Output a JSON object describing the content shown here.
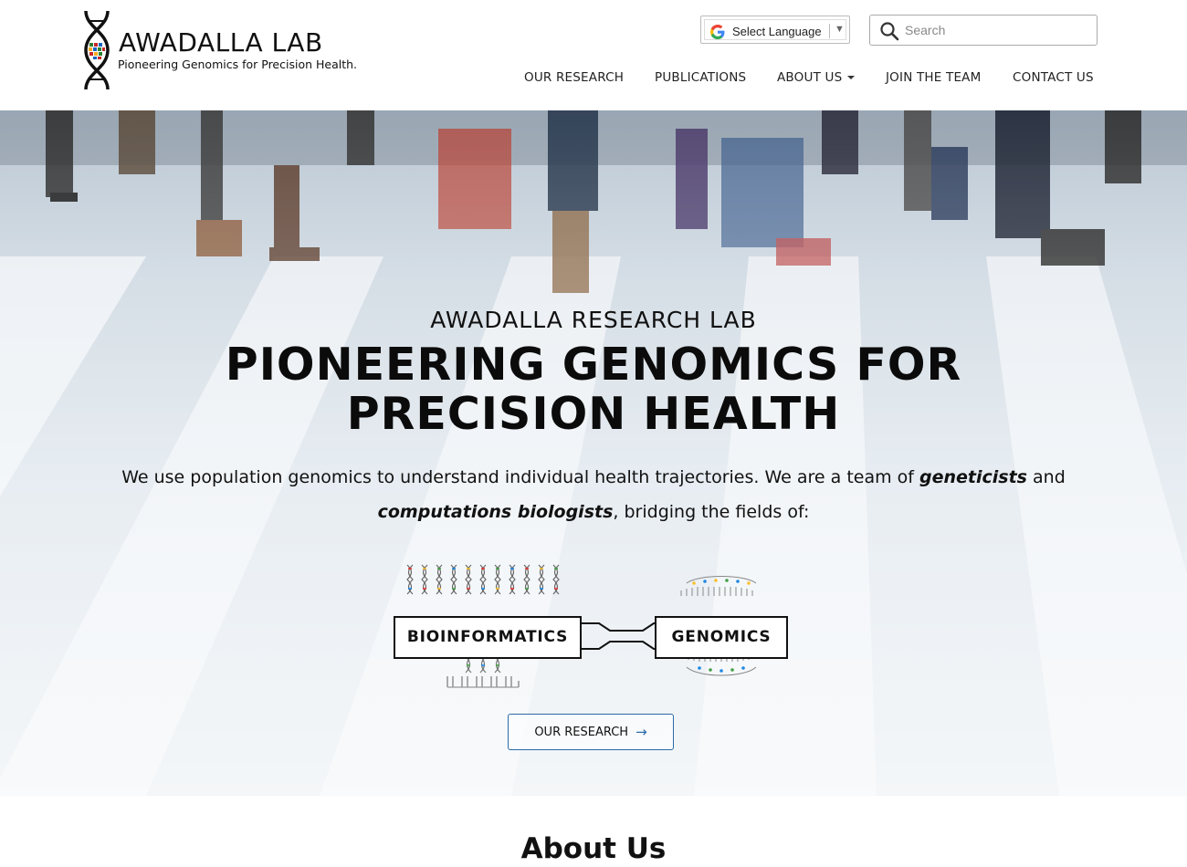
{
  "logo": {
    "title": "AWADALLA LAB",
    "tagline": "Pioneering Genomics for Precision Health."
  },
  "translate": {
    "label": "Select Language",
    "icon": "google-g-icon"
  },
  "search": {
    "placeholder": "Search",
    "value": ""
  },
  "nav": {
    "items": [
      {
        "label": "OUR RESEARCH"
      },
      {
        "label": "PUBLICATIONS"
      },
      {
        "label": "ABOUT US",
        "has_dropdown": true
      },
      {
        "label": "JOIN THE TEAM"
      },
      {
        "label": "CONTACT US"
      }
    ]
  },
  "hero": {
    "eyebrow": "AWADALLA RESEARCH LAB",
    "title": "PIONEERING GENOMICS FOR PRECISION HEALTH",
    "desc_part1": "We use population genomics to understand individual health trajectories. We are a team of ",
    "desc_em1": "geneticists",
    "desc_part2": " and ",
    "desc_em2": "computations biologists",
    "desc_part3": ", bridging the fields of:",
    "field_left": "BIOINFORMATICS",
    "field_right": "GENOMICS",
    "cta_label": "OUR RESEARCH",
    "cta_icon": "arrow-right-icon"
  },
  "about": {
    "heading": "About Us"
  },
  "colors": {
    "accent": "#2b6aa8",
    "text": "#111111",
    "header_bg": "#ffffff"
  }
}
